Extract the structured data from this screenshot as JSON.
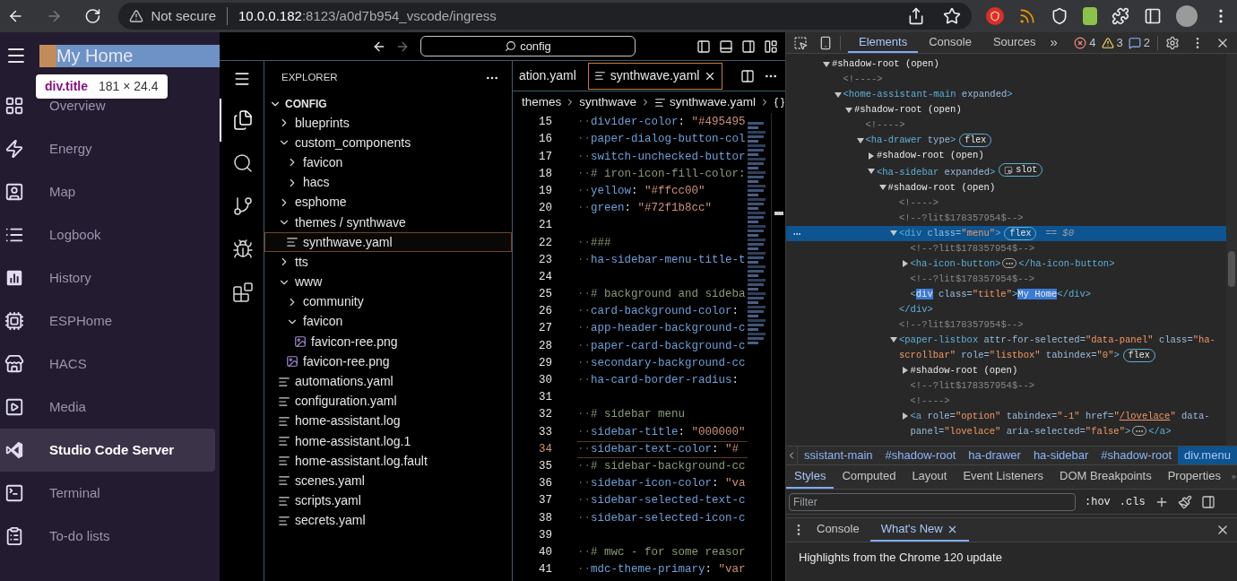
{
  "browser": {
    "back_disabled": false,
    "forward_disabled": true,
    "security": "Not secure",
    "url_host": "10.0.0.182",
    "url_rest": ":8123/a0d7b954_vscode/ingress"
  },
  "ha_sidebar": {
    "title": {
      "text": "My Home",
      "highlighted": true
    },
    "tooltip": {
      "element": "div.title",
      "size": "181 × 24.4"
    },
    "items": [
      {
        "label": "Overview",
        "selected": false
      },
      {
        "label": "Energy",
        "selected": false
      },
      {
        "label": "Map",
        "selected": false
      },
      {
        "label": "Logbook",
        "selected": false
      },
      {
        "label": "History",
        "selected": false
      },
      {
        "label": "ESPHome",
        "selected": false
      },
      {
        "label": "HACS",
        "selected": false
      },
      {
        "label": "Media",
        "selected": false
      },
      {
        "label": "Studio Code Server",
        "selected": true
      },
      {
        "label": "Terminal",
        "selected": false
      },
      {
        "label": "To-do lists",
        "selected": false
      }
    ]
  },
  "vscode": {
    "search": {
      "value": "config"
    },
    "activity_bar": [
      {
        "selected": true
      },
      {
        "selected": false
      },
      {
        "selected": false
      },
      {
        "selected": false
      },
      {
        "selected": false
      }
    ],
    "explorer": {
      "title": "EXPLORER",
      "section": {
        "label": "CONFIG",
        "expanded": true
      },
      "items": [
        {
          "kind": "folder",
          "label": "blueprints",
          "expanded": false,
          "selected": false
        },
        {
          "kind": "folder",
          "label": "custom_components",
          "expanded": true,
          "selected": false,
          "children": [
            {
              "kind": "folder",
              "label": "favicon",
              "expanded": false,
              "selected": false
            },
            {
              "kind": "folder",
              "label": "hacs",
              "expanded": false,
              "selected": false
            }
          ]
        },
        {
          "kind": "folder",
          "label": "esphome",
          "expanded": false,
          "selected": false
        },
        {
          "kind": "folder",
          "label": "themes / synthwave",
          "expanded": true,
          "selected": false,
          "children": [
            {
              "kind": "file",
              "label": "synthwave.yaml",
              "selected": true
            }
          ]
        },
        {
          "kind": "folder",
          "label": "tts",
          "expanded": false,
          "selected": false
        },
        {
          "kind": "folder",
          "label": "www",
          "expanded": true,
          "selected": false,
          "children": [
            {
              "kind": "folder",
              "label": "community",
              "expanded": false,
              "selected": false
            },
            {
              "kind": "folder",
              "label": "favicon",
              "expanded": true,
              "selected": false,
              "children": [
                {
                  "kind": "image",
                  "label": "favicon-ree.png",
                  "selected": false
                }
              ]
            },
            {
              "kind": "image",
              "label": "favicon-ree.png",
              "selected": false
            }
          ]
        },
        {
          "kind": "file",
          "label": "automations.yaml",
          "selected": false
        },
        {
          "kind": "file",
          "label": "configuration.yaml",
          "selected": false
        },
        {
          "kind": "file",
          "label": "home-assistant.log",
          "selected": false
        },
        {
          "kind": "file",
          "label": "home-assistant.log.1",
          "selected": false
        },
        {
          "kind": "file",
          "label": "home-assistant.log.fault",
          "selected": false
        },
        {
          "kind": "file",
          "label": "scenes.yaml",
          "selected": false
        },
        {
          "kind": "file",
          "label": "scripts.yaml",
          "selected": false
        },
        {
          "kind": "file",
          "label": "secrets.yaml",
          "selected": false
        }
      ]
    },
    "tabs": [
      {
        "label": "ation.yaml",
        "selected": false
      },
      {
        "label": "synthwave.yaml",
        "selected": true
      }
    ],
    "breadcrumb": [
      "themes",
      "synthwave",
      "synthwave.yaml"
    ],
    "lines": [
      {
        "number": "15",
        "current": false,
        "segments": [
          {
            "kind": "space",
            "text": "··"
          },
          {
            "kind": "key",
            "text": "divider-color"
          },
          {
            "kind": "punct",
            "text": ": "
          },
          {
            "kind": "string",
            "text": "\"#495495"
          }
        ]
      },
      {
        "number": "16",
        "current": false,
        "segments": [
          {
            "kind": "space",
            "text": "··"
          },
          {
            "kind": "key",
            "text": "paper-dialog-button-col"
          }
        ]
      },
      {
        "number": "17",
        "current": false,
        "segments": [
          {
            "kind": "space",
            "text": "··"
          },
          {
            "kind": "key",
            "text": "switch-unchecked-buttor"
          }
        ]
      },
      {
        "number": "18",
        "current": false,
        "segments": [
          {
            "kind": "space",
            "text": "··"
          },
          {
            "kind": "comment",
            "text": "# iron-icon-fill-color:"
          }
        ]
      },
      {
        "number": "19",
        "current": false,
        "segments": [
          {
            "kind": "space",
            "text": "··"
          },
          {
            "kind": "key",
            "text": "yellow"
          },
          {
            "kind": "punct",
            "text": ": "
          },
          {
            "kind": "string",
            "text": "\"#ffcc00\""
          }
        ]
      },
      {
        "number": "20",
        "current": false,
        "segments": [
          {
            "kind": "space",
            "text": "··"
          },
          {
            "kind": "key",
            "text": "green"
          },
          {
            "kind": "punct",
            "text": ": "
          },
          {
            "kind": "string",
            "text": "\"#72f1b8cc\""
          }
        ]
      },
      {
        "number": "21",
        "current": false
      },
      {
        "number": "22",
        "current": false,
        "segments": [
          {
            "kind": "space",
            "text": "··"
          },
          {
            "kind": "comment",
            "text": "###"
          }
        ]
      },
      {
        "number": "23",
        "current": false,
        "segments": [
          {
            "kind": "space",
            "text": "··"
          },
          {
            "kind": "key",
            "text": "ha-sidebar-menu-title-t"
          }
        ]
      },
      {
        "number": "24",
        "current": false
      },
      {
        "number": "25",
        "current": false,
        "segments": [
          {
            "kind": "space",
            "text": "··"
          },
          {
            "kind": "comment",
            "text": "# background and sideba"
          }
        ]
      },
      {
        "number": "26",
        "current": false,
        "segments": [
          {
            "kind": "space",
            "text": "··"
          },
          {
            "kind": "key",
            "text": "card-background-color"
          },
          {
            "kind": "punct",
            "text": ":"
          }
        ]
      },
      {
        "number": "27",
        "current": false,
        "segments": [
          {
            "kind": "space",
            "text": "··"
          },
          {
            "kind": "key",
            "text": "app-header-background-c"
          }
        ]
      },
      {
        "number": "28",
        "current": false,
        "segments": [
          {
            "kind": "space",
            "text": "··"
          },
          {
            "kind": "key",
            "text": "paper-card-background-c"
          }
        ]
      },
      {
        "number": "29",
        "current": false,
        "segments": [
          {
            "kind": "space",
            "text": "··"
          },
          {
            "kind": "key",
            "text": "secondary-background-cc"
          }
        ]
      },
      {
        "number": "30",
        "current": false,
        "segments": [
          {
            "kind": "space",
            "text": "··"
          },
          {
            "kind": "key",
            "text": "ha-card-border-radius"
          },
          {
            "kind": "punct",
            "text": ":"
          }
        ]
      },
      {
        "number": "31",
        "current": false
      },
      {
        "number": "32",
        "current": false,
        "segments": [
          {
            "kind": "space",
            "text": "··"
          },
          {
            "kind": "comment",
            "text": "# sidebar menu"
          }
        ]
      },
      {
        "number": "33",
        "current": false,
        "segments": [
          {
            "kind": "space",
            "text": "··"
          },
          {
            "kind": "key",
            "text": "sidebar-title"
          },
          {
            "kind": "punct",
            "text": ": "
          },
          {
            "kind": "string",
            "text": "\"000000\""
          }
        ]
      },
      {
        "number": "34",
        "current": true,
        "segments": [
          {
            "kind": "space",
            "text": "··"
          },
          {
            "kind": "key",
            "text": "sidebar-text-color"
          },
          {
            "kind": "punct",
            "text": ": "
          },
          {
            "kind": "string",
            "text": "\"#"
          }
        ]
      },
      {
        "number": "35",
        "current": false,
        "segments": [
          {
            "kind": "space",
            "text": "··"
          },
          {
            "kind": "comment",
            "text": "# sidebar-background-cc"
          }
        ]
      },
      {
        "number": "36",
        "current": false,
        "segments": [
          {
            "kind": "space",
            "text": "··"
          },
          {
            "kind": "key",
            "text": "sidebar-icon-color"
          },
          {
            "kind": "punct",
            "text": ": "
          },
          {
            "kind": "string",
            "text": "\"va"
          }
        ]
      },
      {
        "number": "37",
        "current": false,
        "segments": [
          {
            "kind": "space",
            "text": "··"
          },
          {
            "kind": "key",
            "text": "sidebar-selected-text-c"
          }
        ]
      },
      {
        "number": "38",
        "current": false,
        "segments": [
          {
            "kind": "space",
            "text": "··"
          },
          {
            "kind": "key",
            "text": "sidebar-selected-icon-c"
          }
        ]
      },
      {
        "number": "39",
        "current": false
      },
      {
        "number": "40",
        "current": false,
        "segments": [
          {
            "kind": "space",
            "text": "··"
          },
          {
            "kind": "comment",
            "text": "# mwc - for some reasor"
          }
        ]
      },
      {
        "number": "41",
        "current": false,
        "segments": [
          {
            "kind": "space",
            "text": "··"
          },
          {
            "kind": "key",
            "text": "mdc-theme-primary"
          },
          {
            "kind": "punct",
            "text": ": "
          },
          {
            "kind": "string",
            "text": "\"var"
          }
        ]
      }
    ]
  },
  "devtools": {
    "tabs": [
      {
        "label": "Elements",
        "selected": true
      },
      {
        "label": "Console",
        "selected": false
      },
      {
        "label": "Sources",
        "selected": false
      }
    ],
    "more": "»",
    "errors": "4",
    "warnings": "3",
    "messages": "2",
    "dom_tree": [
      {
        "selected": false,
        "expanded": true,
        "segments": [
          {
            "kind": "text",
            "text": "#shadow-root (open)"
          }
        ],
        "children": [
          {
            "selected": false,
            "segments": [
              {
                "kind": "comment",
                "text": "<!---->"
              }
            ]
          },
          {
            "selected": false,
            "expanded": true,
            "segments": [
              {
                "kind": "tag",
                "text": "<home-assistant-main"
              },
              {
                "kind": "attr",
                "text": " expanded"
              },
              {
                "kind": "tag",
                "text": ">"
              }
            ],
            "children": [
              {
                "selected": false,
                "expanded": true,
                "segments": [
                  {
                    "kind": "text",
                    "text": "#shadow-root (open)"
                  }
                ],
                "children": [
                  {
                    "selected": false,
                    "segments": [
                      {
                        "kind": "comment",
                        "text": "<!---->"
                      }
                    ]
                  },
                  {
                    "selected": false,
                    "expanded": true,
                    "segments": [
                      {
                        "kind": "tag",
                        "text": "<ha-drawer"
                      },
                      {
                        "kind": "attr",
                        "text": " type"
                      },
                      {
                        "kind": "tag",
                        "text": ">"
                      },
                      {
                        "kind": "badge",
                        "text": "flex"
                      }
                    ],
                    "children": [
                      {
                        "selected": false,
                        "expanded": false,
                        "segments": [
                          {
                            "kind": "text",
                            "text": "#shadow-root (open)"
                          }
                        ]
                      },
                      {
                        "selected": false,
                        "expanded": true,
                        "segments": [
                          {
                            "kind": "tag",
                            "text": "<ha-sidebar"
                          },
                          {
                            "kind": "attr",
                            "text": " expanded"
                          },
                          {
                            "kind": "tag",
                            "text": ">"
                          },
                          {
                            "kind": "slot_badge",
                            "text": "slot"
                          }
                        ],
                        "children": [
                          {
                            "selected": false,
                            "expanded": true,
                            "segments": [
                              {
                                "kind": "text",
                                "text": "#shadow-root (open)"
                              }
                            ],
                            "children": [
                              {
                                "selected": false,
                                "segments": [
                                  {
                                    "kind": "comment",
                                    "text": "<!---->"
                                  }
                                ]
                              },
                              {
                                "selected": false,
                                "segments": [
                                  {
                                    "kind": "comment",
                                    "text": "<!--?lit$178357954$-->"
                                  }
                                ]
                              },
                              {
                                "selected": true,
                                "expanded": true,
                                "segments": [
                                  {
                                    "kind": "tag",
                                    "text": "<div"
                                  },
                                  {
                                    "kind": "attr",
                                    "text": " class="
                                  },
                                  {
                                    "kind": "value",
                                    "text": "\"menu\""
                                  },
                                  {
                                    "kind": "tag",
                                    "text": ">"
                                  },
                                  {
                                    "kind": "badge",
                                    "text": "flex"
                                  },
                                  {
                                    "kind": "ref",
                                    "text": "== $0"
                                  }
                                ],
                                "children": [
                                  {
                                    "selected": false,
                                    "segments": [
                                      {
                                        "kind": "comment",
                                        "text": "<!--?lit$178357954$-->"
                                      }
                                    ]
                                  },
                                  {
                                    "selected": false,
                                    "expanded": false,
                                    "segments": [
                                      {
                                        "kind": "tag",
                                        "text": "<ha-icon-button>"
                                      },
                                      {
                                        "kind": "ellipsis"
                                      },
                                      {
                                        "kind": "tag",
                                        "text": "</ha-icon-button>"
                                      }
                                    ]
                                  },
                                  {
                                    "selected": false,
                                    "segments": [
                                      {
                                        "kind": "comment",
                                        "text": "<!--?lit$178357954$-->"
                                      }
                                    ]
                                  },
                                  {
                                    "selected": false,
                                    "segments": [
                                      {
                                        "kind": "tag",
                                        "text": "<"
                                      },
                                      {
                                        "kind": "match",
                                        "text": "div"
                                      },
                                      {
                                        "kind": "attr",
                                        "text": " class="
                                      },
                                      {
                                        "kind": "value",
                                        "text": "\"title\""
                                      },
                                      {
                                        "kind": "tag",
                                        "text": ">"
                                      },
                                      {
                                        "kind": "match",
                                        "text": "My Home"
                                      },
                                      {
                                        "kind": "tag",
                                        "text": "</div>"
                                      }
                                    ]
                                  }
                                ]
                              },
                              {
                                "selected": false,
                                "segments": [
                                  {
                                    "kind": "tag",
                                    "text": "</div>"
                                  }
                                ]
                              },
                              {
                                "selected": false,
                                "segments": [
                                  {
                                    "kind": "comment",
                                    "text": "<!--?lit$178357954$-->"
                                  }
                                ]
                              },
                              {
                                "selected": false,
                                "expanded": true,
                                "segments": [
                                  {
                                    "kind": "tag",
                                    "text": "<paper-listbox"
                                  },
                                  {
                                    "kind": "attr",
                                    "text": " attr-for-selected="
                                  },
                                  {
                                    "kind": "value",
                                    "text": "\"data-panel\""
                                  },
                                  {
                                    "kind": "attr",
                                    "text": " class="
                                  },
                                  {
                                    "kind": "value",
                                    "text": "\"ha-scrollbar\""
                                  },
                                  {
                                    "kind": "attr",
                                    "text": " role="
                                  },
                                  {
                                    "kind": "value",
                                    "text": "\"listbox\""
                                  },
                                  {
                                    "kind": "attr",
                                    "text": " tabindex="
                                  },
                                  {
                                    "kind": "value",
                                    "text": "\"0\""
                                  },
                                  {
                                    "kind": "tag",
                                    "text": ">"
                                  },
                                  {
                                    "kind": "badge",
                                    "text": "flex"
                                  }
                                ],
                                "children": [
                                  {
                                    "selected": false,
                                    "expanded": false,
                                    "segments": [
                                      {
                                        "kind": "text",
                                        "text": "#shadow-root (open)"
                                      }
                                    ]
                                  },
                                  {
                                    "selected": false,
                                    "segments": [
                                      {
                                        "kind": "comment",
                                        "text": "<!--?lit$178357954$-->"
                                      }
                                    ]
                                  },
                                  {
                                    "selected": false,
                                    "segments": [
                                      {
                                        "kind": "comment",
                                        "text": "<!---->"
                                      }
                                    ]
                                  },
                                  {
                                    "selected": false,
                                    "expanded": false,
                                    "segments": [
                                      {
                                        "kind": "tag",
                                        "text": "<a"
                                      },
                                      {
                                        "kind": "attr",
                                        "text": " role="
                                      },
                                      {
                                        "kind": "value",
                                        "text": "\"option\""
                                      },
                                      {
                                        "kind": "attr",
                                        "text": " tabindex="
                                      },
                                      {
                                        "kind": "value",
                                        "text": "\"-1\""
                                      },
                                      {
                                        "kind": "attr",
                                        "text": " href="
                                      },
                                      {
                                        "kind": "value",
                                        "text": "\""
                                      },
                                      {
                                        "kind": "link",
                                        "text": "/lovelace"
                                      },
                                      {
                                        "kind": "value",
                                        "text": "\""
                                      },
                                      {
                                        "kind": "attr",
                                        "text": " data-panel="
                                      },
                                      {
                                        "kind": "value",
                                        "text": "\"lovelace\""
                                      },
                                      {
                                        "kind": "attr",
                                        "text": " aria-selected="
                                      },
                                      {
                                        "kind": "value",
                                        "text": "\"false\""
                                      },
                                      {
                                        "kind": "tag",
                                        "text": ">"
                                      },
                                      {
                                        "kind": "ellipsis"
                                      },
                                      {
                                        "kind": "tag",
                                        "text": "</a>"
                                      }
                                    ]
                                  }
                                ]
                              }
                            ]
                          }
                        ]
                      }
                    ]
                  }
                ]
              }
            ]
          }
        ]
      }
    ],
    "crumbs": [
      {
        "label": "ssistant-main",
        "selected": false
      },
      {
        "label": "#shadow-root",
        "selected": false
      },
      {
        "label": "ha-drawer",
        "selected": false
      },
      {
        "label": "ha-sidebar",
        "selected": false
      },
      {
        "label": "#shadow-root",
        "selected": false
      },
      {
        "label": "div.menu",
        "selected": true
      }
    ],
    "pane_tabs": [
      {
        "label": "Styles",
        "selected": true
      },
      {
        "label": "Computed",
        "selected": false
      },
      {
        "label": "Layout",
        "selected": false
      },
      {
        "label": "Event Listeners",
        "selected": false
      },
      {
        "label": "DOM Breakpoints",
        "selected": false
      },
      {
        "label": "Properties",
        "selected": false
      }
    ],
    "filter": {
      "placeholder": "Filter"
    },
    "hov": ":hov",
    "cls": ".cls",
    "drawer_tabs": [
      {
        "label": "Console",
        "selected": false,
        "closable": false
      },
      {
        "label": "What's New",
        "selected": true,
        "closable": true
      }
    ],
    "drawer_text": "Highlights from the Chrome 120 update"
  }
}
